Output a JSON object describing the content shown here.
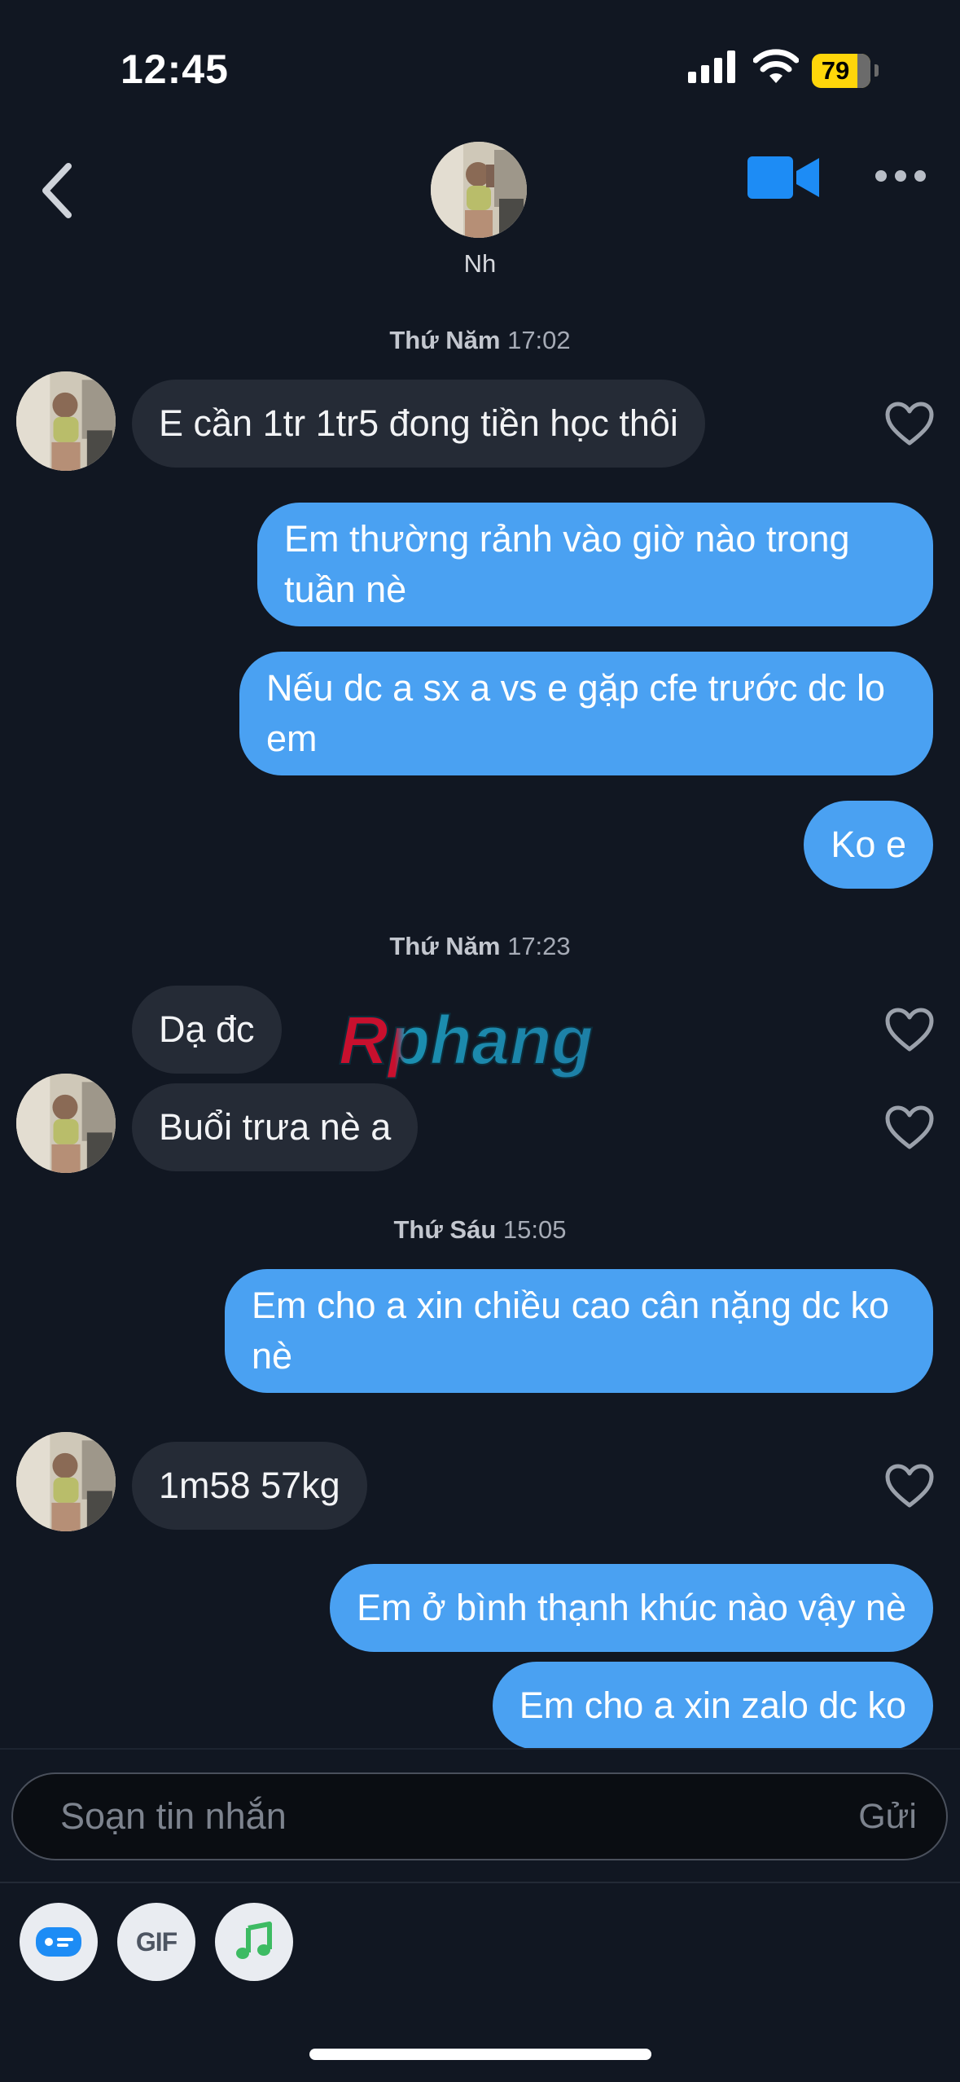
{
  "status_bar": {
    "time": "12:45",
    "battery": "79"
  },
  "header": {
    "contact_name": "Nh"
  },
  "messages": {
    "d1": {
      "day": "Thứ Năm",
      "time": "17:02"
    },
    "m1": "E cần 1tr 1tr5 đong tiền học thôi",
    "m2": "Em thường rảnh vào giờ nào trong tuần nè",
    "m3": "Nếu dc a sx a vs e gặp cfe trước dc lo em",
    "m4": "Ko e",
    "d2": {
      "day": "Thứ Năm",
      "time": "17:23"
    },
    "m5": "Dạ đc",
    "m6": "Buổi trưa nè a",
    "d3": {
      "day": "Thứ Sáu",
      "time": "15:05"
    },
    "m7": "Em cho a xin chiều cao cân nặng dc ko nè",
    "m8": "1m58 57kg",
    "m9": "Em ở bình thạnh khúc nào vậy nè",
    "m10": "Em cho a xin zalo dc ko"
  },
  "watermark": "Rphang",
  "composer": {
    "placeholder": "Soạn tin nhắn",
    "send_label": "Gửi",
    "gif_label": "GIF"
  },
  "colors": {
    "background": "#111722",
    "outgoing_bubble": "#4aa1f2",
    "incoming_bubble": "#252b36",
    "accent": "#1d8cf5",
    "music": "#3dbb63"
  }
}
